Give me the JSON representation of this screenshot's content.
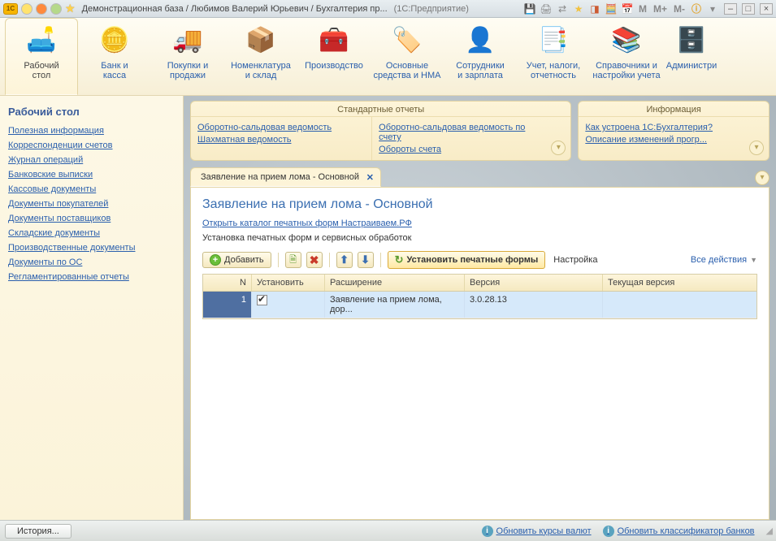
{
  "titlebar": {
    "title": "Демонстрационная база / Любимов Валерий Юрьевич / Бухгалтерия пр...",
    "hint": "(1С:Предприятие)",
    "M": "M",
    "Mplus": "M+",
    "Mminus": "M-"
  },
  "ribbon": [
    {
      "label": "Рабочий\nстол",
      "icon": "🛋️"
    },
    {
      "label": "Банк и\nкасса",
      "icon": "🪙"
    },
    {
      "label": "Покупки и\nпродажи",
      "icon": "🚚"
    },
    {
      "label": "Номенклатура\nи склад",
      "icon": "📦"
    },
    {
      "label": "Производство",
      "icon": "🧰"
    },
    {
      "label": "Основные\nсредства и НМА",
      "icon": "🏷️"
    },
    {
      "label": "Сотрудники\nи зарплата",
      "icon": "👤"
    },
    {
      "label": "Учет, налоги,\nотчетность",
      "icon": "📑"
    },
    {
      "label": "Справочники и\nнастройки учета",
      "icon": "📚"
    },
    {
      "label": "Администри",
      "icon": "🗄️"
    }
  ],
  "sidebar": {
    "heading": "Рабочий стол",
    "links": [
      "Полезная информация",
      "Корреспонденции счетов",
      "Журнал операций",
      "Банковские выписки",
      "Кассовые документы",
      "Документы покупателей",
      "Документы поставщиков",
      "Складские документы",
      "Производственные документы",
      "Документы по ОС",
      "Регламентированные отчеты"
    ]
  },
  "panels": {
    "reports": {
      "title": "Стандартные отчеты",
      "left": [
        "Оборотно-сальдовая ведомость",
        "Шахматная ведомость"
      ],
      "right": [
        "Оборотно-сальдовая ведомость по счету",
        "Обороты счета"
      ]
    },
    "info": {
      "title": "Информация",
      "items": [
        "Как устроена 1С:Бухгалтерия?",
        "Описание изменений прогр..."
      ]
    }
  },
  "tab": {
    "label": "Заявление на прием лома - Основной"
  },
  "doc": {
    "title": "Заявление на прием лома - Основной",
    "link": "Открыть каталог печатных форм Настраиваем.РФ",
    "text": "Установка печатных форм и сервисных обработок"
  },
  "toolbar": {
    "add": "Добавить",
    "install": "Установить печатные формы",
    "settings": "Настройка",
    "allactions": "Все действия"
  },
  "grid": {
    "head": {
      "n": "N",
      "set": "Установить",
      "ext": "Расширение",
      "ver": "Версия",
      "cur": "Текущая версия"
    },
    "row": {
      "n": "1",
      "ext": "Заявление на прием лома, дор...",
      "ver": "3.0.28.13"
    }
  },
  "status": {
    "history": "История...",
    "rates": "Обновить курсы валют",
    "banks": "Обновить классификатор банков"
  }
}
